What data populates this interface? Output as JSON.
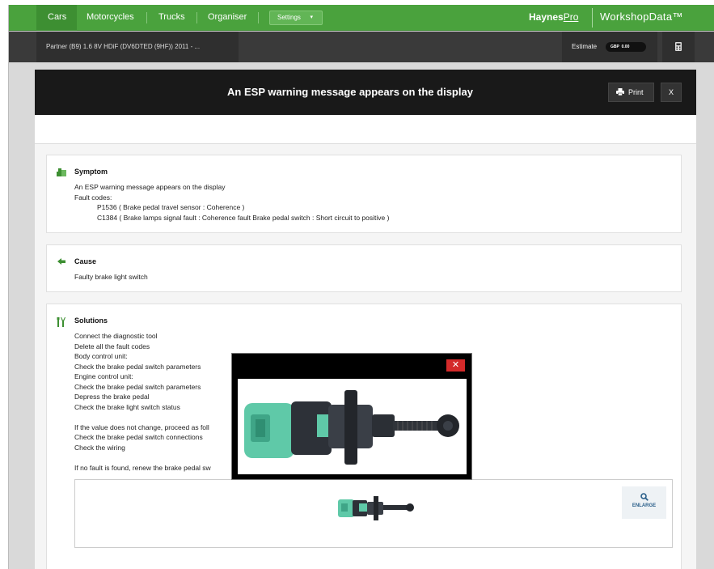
{
  "nav": {
    "items": [
      "Cars",
      "Motorcycles",
      "Trucks",
      "Organiser"
    ],
    "settings_label": "Settings",
    "settings_caret": "▾",
    "brand_left": "Haynes",
    "brand_pro": "Pro",
    "brand_right": "WorkshopData™"
  },
  "subbar": {
    "vehicle": "Partner (B9) 1.6 8V HDiF (DV6DTED (9HF)) 2011 - ...",
    "estimate_label": "Estimate",
    "currency": "GBP",
    "amount": "0.00",
    "calc_icon": "calculator-icon"
  },
  "panel": {
    "title": "An ESP warning message appears on the display",
    "print_label": "Print",
    "close_label": "X"
  },
  "symptom": {
    "title": "Symptom",
    "lines": [
      "An ESP warning message appears on the display",
      "Fault codes:"
    ],
    "codes": [
      "P1536 ( Brake pedal travel sensor : Coherence )",
      "C1384 ( Brake lamps signal fault : Coherence fault Brake pedal switch : Short circuit to positive )"
    ]
  },
  "cause": {
    "title": "Cause",
    "text": "Faulty brake light switch"
  },
  "solutions": {
    "title": "Solutions",
    "steps": [
      "Connect the diagnostic tool",
      "Delete all the fault codes",
      "Body control unit:",
      "Check the brake pedal switch parameters",
      "Engine control unit:",
      "Check the brake pedal switch parameters",
      "Depress the brake pedal",
      "Check the brake light switch status"
    ],
    "if_value": [
      "If the value does not change, proceed as foll",
      "Check the brake pedal switch connections",
      "Check the wiring"
    ],
    "if_no_fault": "If no fault is found, renew the brake pedal sw",
    "enlarge_label": "ENLARGE"
  },
  "popup": {
    "close_label": "✕"
  },
  "colors": {
    "nav_green": "#4aa23d",
    "dark_header": "#191919",
    "popup_close": "#d42a2a",
    "part_teal": "#5fc9a8"
  }
}
